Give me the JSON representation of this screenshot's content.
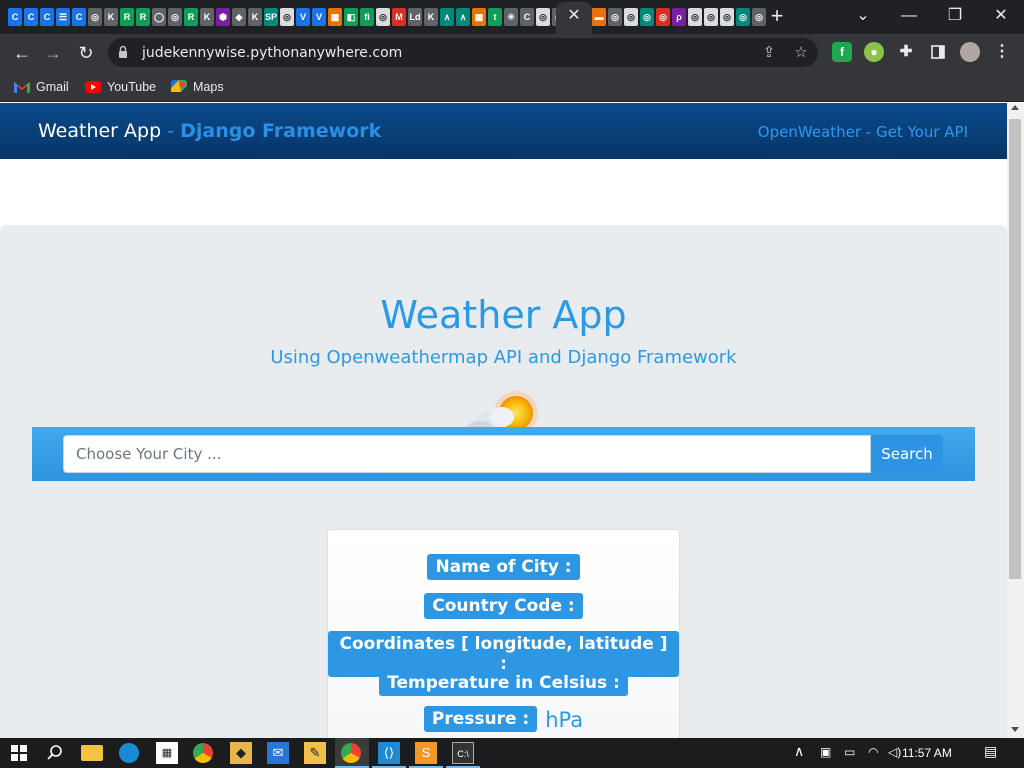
{
  "browser": {
    "url": "judekennywise.pythonanywhere.com",
    "tab_close": "✕",
    "new_tab": "+",
    "window_controls": {
      "minimize": "—",
      "restore": "❐",
      "close": "✕",
      "tab_search": "⌄"
    },
    "nav": {
      "back": "←",
      "forward": "→",
      "reload": "↻"
    },
    "bookmarks": [
      {
        "label": "Gmail",
        "icon": "gmail-icon"
      },
      {
        "label": "YouTube",
        "icon": "youtube-icon"
      },
      {
        "label": "Maps",
        "icon": "maps-icon"
      }
    ],
    "tab_favicons": [
      "C",
      "C",
      "C",
      "☰",
      "C",
      "◎",
      "K",
      "R",
      "R",
      "◯",
      "◎",
      "R",
      "K",
      "⬢",
      "◆",
      "K",
      "SP",
      "◎",
      "V",
      "V",
      "▦",
      "◧",
      "fi",
      "◎",
      "M",
      "Ld",
      "K",
      "∧",
      "∧",
      "▦",
      "t",
      "✳",
      "C",
      "◎",
      "◎",
      "ESL",
      "◎"
    ],
    "tab_favicons_right": [
      "▬",
      "◎",
      "◎",
      "◎",
      "◎",
      "ρ",
      "◎",
      "◎",
      "◎",
      "◎",
      "◎"
    ]
  },
  "site": {
    "brand_main": "Weather App",
    "brand_sep": " - ",
    "brand_framework": "Django Framework",
    "nav_link": "OpenWeather - Get Your API",
    "hero_title": "Weather App",
    "hero_subtitle": "Using Openweathermap API and Django Framework",
    "search": {
      "placeholder": "Choose Your City ...",
      "button": "Search"
    },
    "result": {
      "city_label": "Name of City :",
      "country_label": "Country Code :",
      "coords_label": "Coordinates [ longitude, latitude ] :",
      "temp_label": "Temperature in Celsius :",
      "pressure_label": "Pressure :",
      "pressure_unit": "hPa"
    }
  },
  "taskbar": {
    "clock": "11:57 AM",
    "tray_chevron": "∧"
  }
}
